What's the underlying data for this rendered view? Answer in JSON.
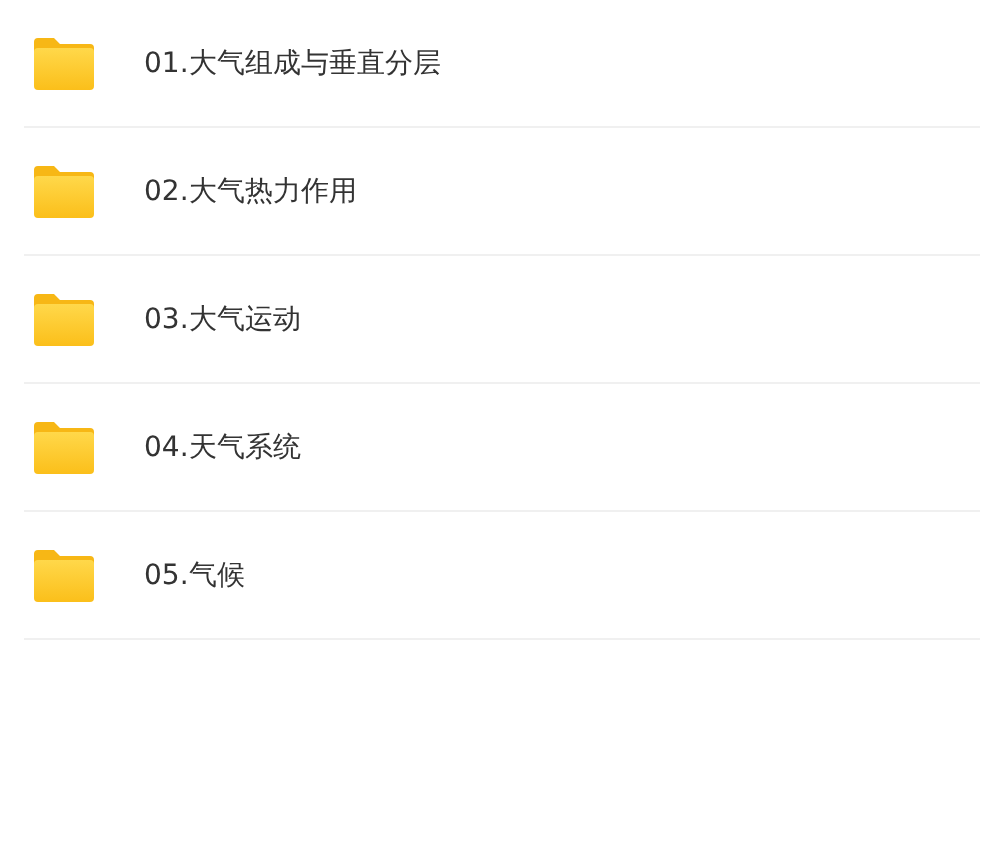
{
  "folders": [
    {
      "name": "01.大气组成与垂直分层"
    },
    {
      "name": "02.大气热力作用"
    },
    {
      "name": "03.大气运动"
    },
    {
      "name": "04.天气系统"
    },
    {
      "name": "05.气候"
    }
  ]
}
